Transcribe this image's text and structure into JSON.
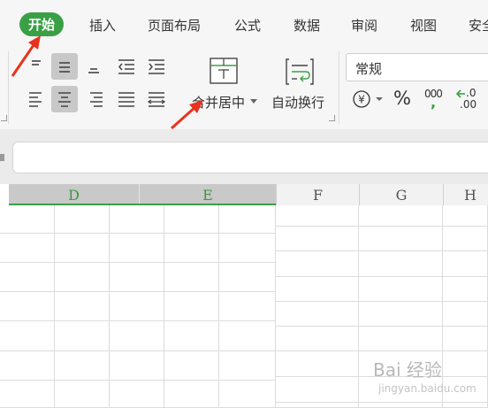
{
  "tabs": [
    {
      "label": "开始",
      "active": true
    },
    {
      "label": "插入"
    },
    {
      "label": "页面布局"
    },
    {
      "label": "公式"
    },
    {
      "label": "数据"
    },
    {
      "label": "审阅"
    },
    {
      "label": "视图"
    },
    {
      "label": "安全"
    }
  ],
  "alignment": {
    "merge_label": "合并居中",
    "wrap_label": "自动换行"
  },
  "number_format": {
    "value": "常规",
    "currency_symbol": "¥",
    "percent_symbol": "%",
    "thousands_top": "000",
    "thousands_bottom": ",",
    "inc_decimal_top": ".0",
    "inc_decimal_bottom": ".00"
  },
  "columns": [
    {
      "label": "D",
      "selected": true
    },
    {
      "label": "E",
      "selected": true
    },
    {
      "label": "F"
    },
    {
      "label": "G"
    },
    {
      "label": "H"
    }
  ],
  "watermark": {
    "text": "Bai 经验",
    "sub": "jingyan.baidu.com"
  },
  "colors": {
    "accent": "#3aa046",
    "arrow": "#e8321e"
  }
}
